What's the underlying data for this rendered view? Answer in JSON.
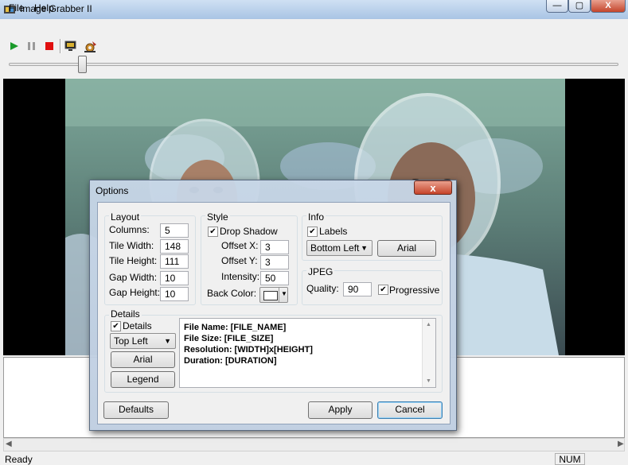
{
  "window": {
    "title": "Image Grabber II",
    "min_label": "—",
    "max_label": "▢",
    "close_label": "X"
  },
  "menu": {
    "file": "File",
    "help": "Help"
  },
  "status": {
    "text": "Ready",
    "num": "NUM"
  },
  "icons": {
    "play": "play-icon",
    "pause": "pause-icon",
    "stop": "stop-icon",
    "monitor": "monitor-icon",
    "settings": "settings-icon"
  },
  "dialog": {
    "title": "Options",
    "close_label": "x",
    "layout": {
      "title": "Layout",
      "columns_label": "Columns:",
      "columns": "5",
      "tile_width_label": "Tile Width:",
      "tile_width": "148",
      "tile_height_label": "Tile Height:",
      "tile_height": "111",
      "gap_width_label": "Gap Width:",
      "gap_width": "10",
      "gap_height_label": "Gap Height:",
      "gap_height": "10"
    },
    "style": {
      "title": "Style",
      "drop_shadow_label": "Drop Shadow",
      "drop_shadow_checked": true,
      "offset_x_label": "Offset X:",
      "offset_x": "3",
      "offset_y_label": "Offset Y:",
      "offset_y": "3",
      "intensity_label": "Intensity:",
      "intensity": "50",
      "back_color_label": "Back Color:"
    },
    "info": {
      "title": "Info",
      "labels_label": "Labels",
      "labels_checked": true,
      "position": "Bottom Left",
      "font_button": "Arial"
    },
    "jpeg": {
      "title": "JPEG",
      "quality_label": "Quality:",
      "quality": "90",
      "progressive_label": "Progressive",
      "progressive_checked": true
    },
    "details": {
      "title": "Details",
      "details_label": "Details",
      "details_checked": true,
      "position": "Top Left",
      "font_button": "Arial",
      "legend_button": "Legend",
      "lines": [
        "File Name: [FILE_NAME]",
        "File Size: [FILE_SIZE]",
        "Resolution: [WIDTH]x[HEIGHT]",
        "Duration: [DURATION]"
      ]
    },
    "defaults_button": "Defaults",
    "apply_button": "Apply",
    "cancel_button": "Cancel"
  }
}
